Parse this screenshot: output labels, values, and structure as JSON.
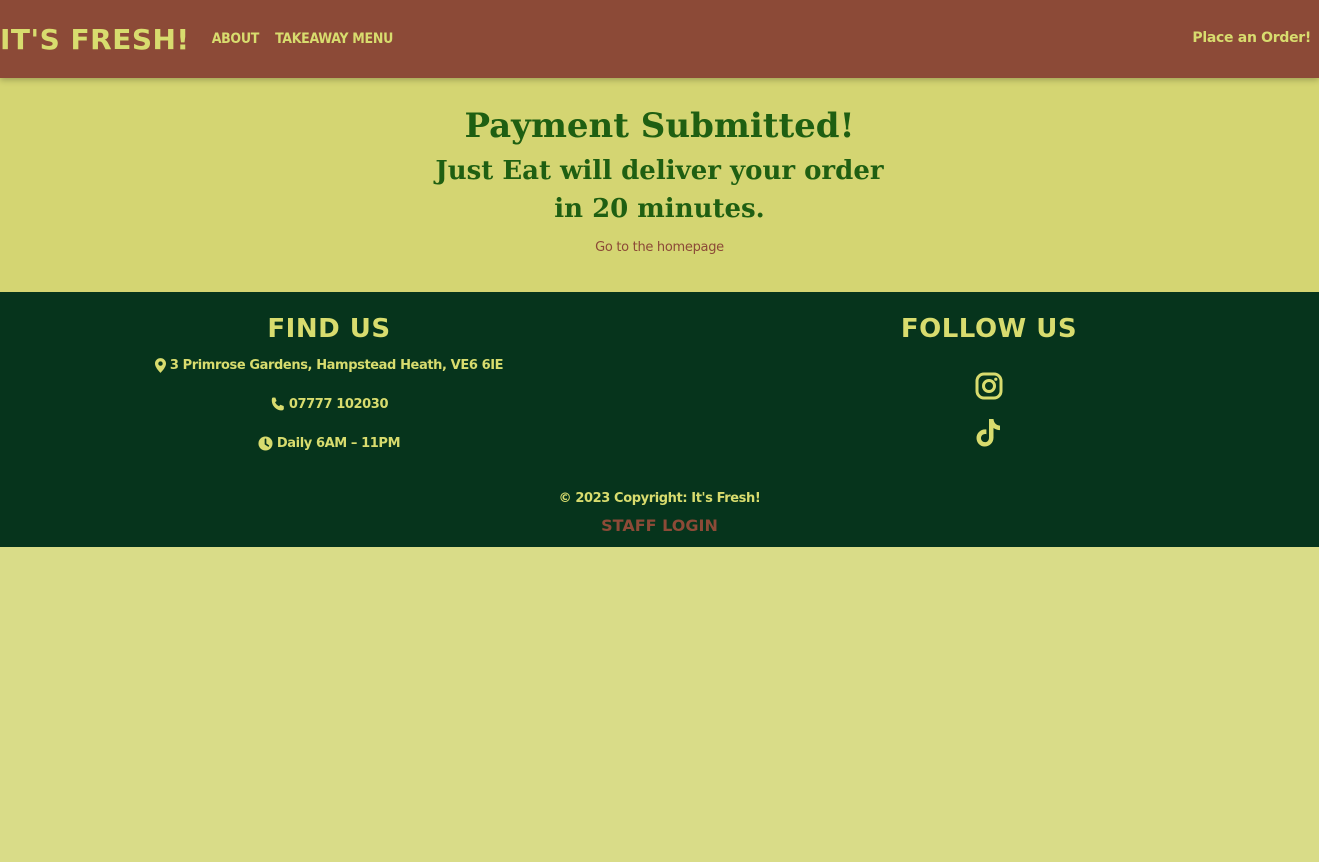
{
  "navbar": {
    "brand": "IT'S FRESH!",
    "links": [
      "ABOUT",
      "TAKEAWAY MENU"
    ],
    "cta": "Place an Order!"
  },
  "main": {
    "title": "Payment Submitted!",
    "subtitle": "Just Eat will deliver your order in 20 minutes.",
    "home_link": "Go to the homepage"
  },
  "footer": {
    "find_us": {
      "heading": "FIND US",
      "address": "3 Primrose Gardens, Hampstead Heath, VE6 6IE",
      "phone": "07777 102030",
      "hours": "Daily 6AM – 11PM"
    },
    "follow_us": {
      "heading": "FOLLOW US",
      "icons": [
        "instagram-icon",
        "tiktok-icon"
      ]
    },
    "copyright": "© 2023 Copyright: It's Fresh!",
    "staff_login": "STAFF LOGIN"
  },
  "colors": {
    "navbar": "#8c4a37",
    "accent_text": "#d8dc6e",
    "main_bg": "#d4d572",
    "heading_green": "#1f5f12",
    "footer_bg": "#06341c",
    "page_bg": "#d9dc88"
  }
}
